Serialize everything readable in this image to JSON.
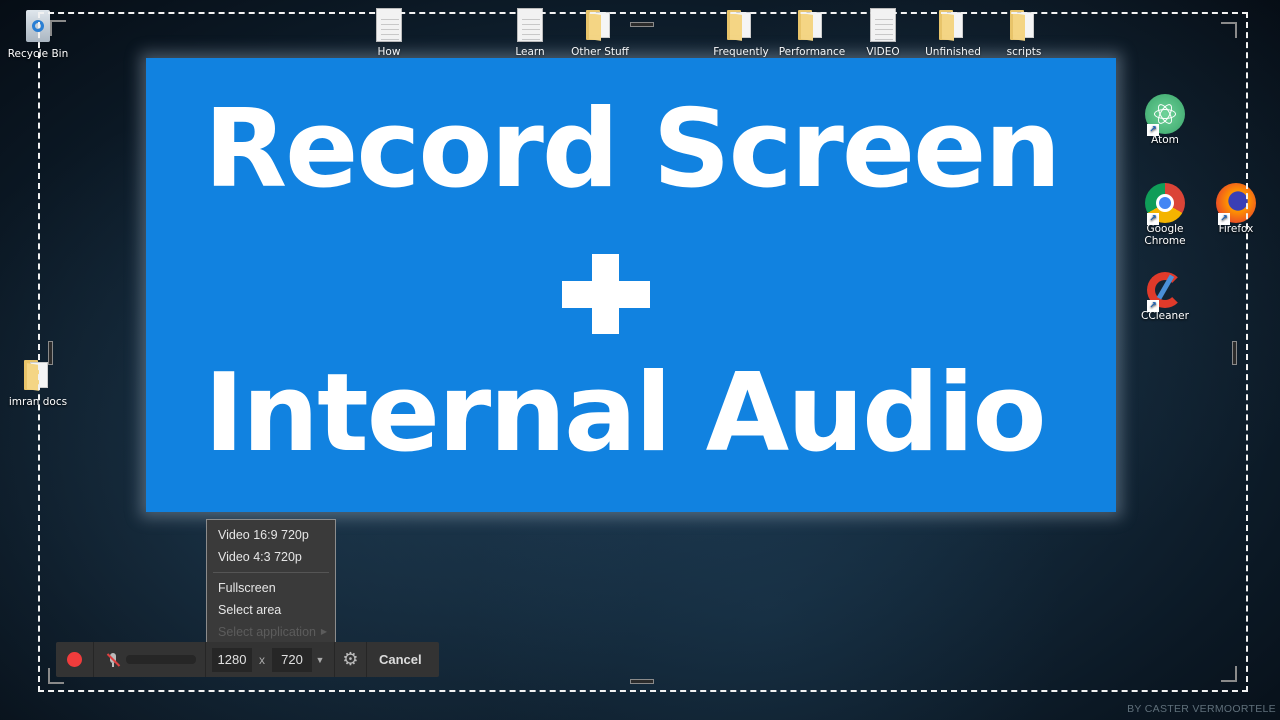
{
  "desktop": {
    "icons_top": [
      {
        "label": "Recycle Bin",
        "type": "recycle-bin"
      },
      {
        "label": "How",
        "type": "document"
      },
      {
        "label": "Learn",
        "type": "document"
      },
      {
        "label": "Other Stuff",
        "type": "folder"
      },
      {
        "label": "Frequently",
        "type": "folder"
      },
      {
        "label": "Performance",
        "type": "folder"
      },
      {
        "label": "VIDEO",
        "type": "document"
      },
      {
        "label": "Unfinished",
        "type": "folder"
      },
      {
        "label": "scripts",
        "type": "folder"
      }
    ],
    "icons_right": [
      {
        "label": "Atom",
        "type": "atom-app"
      },
      {
        "label": "Google Chrome",
        "type": "chrome-app"
      },
      {
        "label": "Firefox",
        "type": "firefox-app"
      },
      {
        "label": "CCleaner",
        "type": "ccleaner-app"
      }
    ],
    "icons_left": [
      {
        "label": "imran docs",
        "type": "folder"
      }
    ]
  },
  "banner": {
    "line1": "Record Screen",
    "line2": "+",
    "line3": "Internal Audio",
    "color": "#1182e0"
  },
  "capture_menu": {
    "items": [
      {
        "label": "Video 16:9 720p",
        "enabled": true
      },
      {
        "label": "Video 4:3 720p",
        "enabled": true
      },
      {
        "label": "Fullscreen",
        "enabled": true
      },
      {
        "label": "Select area",
        "enabled": true
      },
      {
        "label": "Select application",
        "enabled": false,
        "submenu": true
      }
    ]
  },
  "toolbar": {
    "record_icon": "record-icon",
    "mic_icon": "mic-muted-icon",
    "width_value": "1280",
    "times_label": "x",
    "height_value": "720",
    "dropdown_icon": "caret-down-icon",
    "settings_icon": "gear-icon",
    "cancel_label": "Cancel",
    "record_color": "#f03c3c"
  },
  "watermark": "BY CASTER VERMOORTELE"
}
